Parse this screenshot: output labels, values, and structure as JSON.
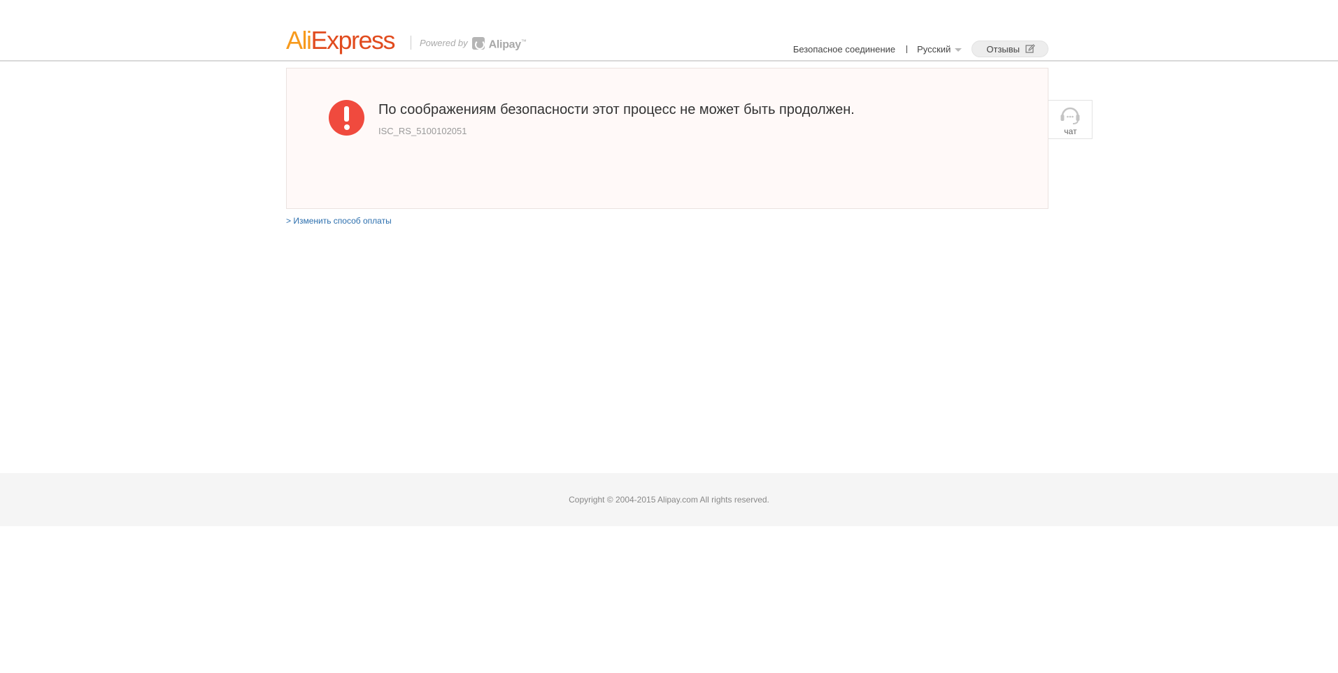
{
  "header": {
    "logo": {
      "part1": "Ali",
      "part2": "Express"
    },
    "powered_by": "Powered by",
    "alipay": "Alipay",
    "secure_connection": "Безопасное соединение",
    "language": "Русский",
    "feedback": "Отзывы"
  },
  "error": {
    "message": "По соображениям безопасности этот процесс не может быть продолжен.",
    "code": "ISC_RS_5100102051"
  },
  "chat": {
    "label": "чат"
  },
  "change_payment": "> Изменить способ оплаты",
  "footer": {
    "copyright": "Copyright © 2004-2015 Alipay.com All rights reserved."
  },
  "colors": {
    "ali_orange": "#f79a1c",
    "express_red": "#e14b1e",
    "error_red": "#f04a3e",
    "error_box_bg": "#fff9f8",
    "link_blue": "#2c6fae"
  },
  "icons": {
    "error": "exclamation-circle-icon",
    "chat": "headset-icon",
    "feedback": "edit-icon",
    "language": "chevron-down-icon",
    "alipay": "alipay-logo-icon"
  }
}
